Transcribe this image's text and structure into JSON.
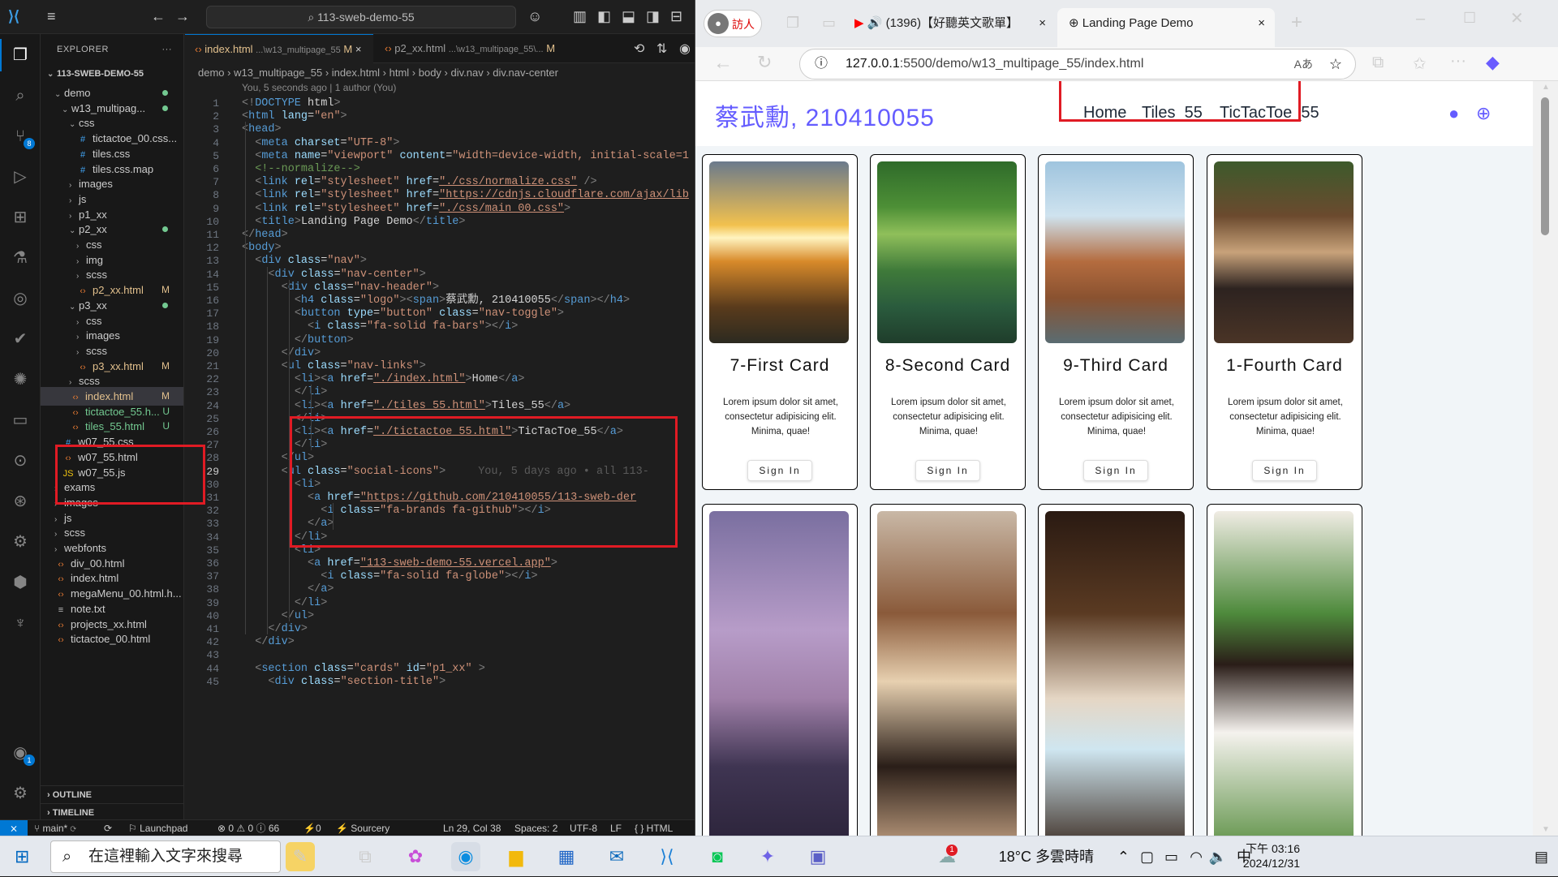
{
  "vscode": {
    "command_center": "113-sweb-demo-55",
    "explorer": {
      "title": "EXPLORER",
      "more": "···",
      "root": "113-SWEB-DEMO-55",
      "items": [
        {
          "label": "demo",
          "indent": 1,
          "type": "folder",
          "open": true,
          "state": "dot"
        },
        {
          "label": "w13_multipag...",
          "indent": 2,
          "type": "folder",
          "open": true,
          "state": "dot"
        },
        {
          "label": "css",
          "indent": 3,
          "type": "folder",
          "open": true,
          "state": ""
        },
        {
          "label": "tictactoe_00.css...",
          "indent": 4,
          "type": "css",
          "state": ""
        },
        {
          "label": "tiles.css",
          "indent": 4,
          "type": "css",
          "state": ""
        },
        {
          "label": "tiles.css.map",
          "indent": 4,
          "type": "css",
          "state": ""
        },
        {
          "label": "images",
          "indent": 3,
          "type": "folder",
          "open": false,
          "state": ""
        },
        {
          "label": "js",
          "indent": 3,
          "type": "folder",
          "open": false,
          "state": ""
        },
        {
          "label": "p1_xx",
          "indent": 3,
          "type": "folder",
          "open": false,
          "state": ""
        },
        {
          "label": "p2_xx",
          "indent": 3,
          "type": "folder",
          "open": true,
          "state": "dot"
        },
        {
          "label": "css",
          "indent": 4,
          "type": "folder",
          "open": false,
          "state": ""
        },
        {
          "label": "img",
          "indent": 4,
          "type": "folder",
          "open": false,
          "state": ""
        },
        {
          "label": "scss",
          "indent": 4,
          "type": "folder",
          "open": false,
          "state": ""
        },
        {
          "label": "p2_xx.html",
          "indent": 4,
          "type": "html",
          "state": "M"
        },
        {
          "label": "p3_xx",
          "indent": 3,
          "type": "folder",
          "open": true,
          "state": "dot"
        },
        {
          "label": "css",
          "indent": 4,
          "type": "folder",
          "open": false,
          "state": ""
        },
        {
          "label": "images",
          "indent": 4,
          "type": "folder",
          "open": false,
          "state": ""
        },
        {
          "label": "scss",
          "indent": 4,
          "type": "folder",
          "open": false,
          "state": ""
        },
        {
          "label": "p3_xx.html",
          "indent": 4,
          "type": "html",
          "state": "M"
        },
        {
          "label": "scss",
          "indent": 3,
          "type": "folder",
          "open": false,
          "state": ""
        },
        {
          "label": "index.html",
          "indent": 3,
          "type": "html",
          "state": "M",
          "selected": true
        },
        {
          "label": "tictactoe_55.h...",
          "indent": 3,
          "type": "html",
          "state": "U"
        },
        {
          "label": "tiles_55.html",
          "indent": 3,
          "type": "html",
          "state": "U"
        },
        {
          "label": "w07_55.css",
          "indent": 2,
          "type": "css",
          "state": ""
        },
        {
          "label": "w07_55.html",
          "indent": 2,
          "type": "html",
          "state": ""
        },
        {
          "label": "w07_55.js",
          "indent": 2,
          "type": "js",
          "state": ""
        },
        {
          "label": "exams",
          "indent": 1,
          "type": "folder",
          "open": false,
          "state": ""
        },
        {
          "label": "images",
          "indent": 1,
          "type": "folder",
          "open": false,
          "state": ""
        },
        {
          "label": "js",
          "indent": 1,
          "type": "folder",
          "open": false,
          "state": ""
        },
        {
          "label": "scss",
          "indent": 1,
          "type": "folder",
          "open": false,
          "state": ""
        },
        {
          "label": "webfonts",
          "indent": 1,
          "type": "folder",
          "open": false,
          "state": ""
        },
        {
          "label": "div_00.html",
          "indent": 1,
          "type": "html",
          "state": ""
        },
        {
          "label": "index.html",
          "indent": 1,
          "type": "html",
          "state": ""
        },
        {
          "label": "megaMenu_00.html.h...",
          "indent": 1,
          "type": "html",
          "state": ""
        },
        {
          "label": "note.txt",
          "indent": 1,
          "type": "txt",
          "state": ""
        },
        {
          "label": "projects_xx.html",
          "indent": 1,
          "type": "html",
          "state": ""
        },
        {
          "label": "tictactoe_00.html",
          "indent": 1,
          "type": "html",
          "state": ""
        }
      ],
      "outline": "OUTLINE",
      "timeline": "TIMELINE"
    },
    "tabs": [
      {
        "name": "index.html",
        "path": "...\\w13_multipage_55",
        "state": "M",
        "close": "×"
      },
      {
        "name": "p2_xx.html",
        "path": "...\\w13_multipage_55\\...",
        "state": "M"
      }
    ],
    "breadcrumb": [
      "demo",
      "w13_multipage_55",
      "index.html",
      "html",
      "body",
      "div.nav",
      "div.nav-center"
    ],
    "blame": "You, 5 seconds ago | 1 author (You)",
    "inline_blame": "You, 5 days ago • all 113-",
    "code": [
      "<!DOCTYPE html>",
      "<html lang=\"en\">",
      "<head>",
      "  <meta charset=\"UTF-8\">",
      "  <meta name=\"viewport\" content=\"width=device-width, initial-scale=1",
      "  <!--normalize-->",
      "  <link rel=\"stylesheet\" href=\"./css/normalize.css\" />",
      "  <link rel=\"stylesheet\" href=\"https://cdnjs.cloudflare.com/ajax/lib",
      "  <link rel=\"stylesheet\" href=\"./css/main_00.css\">",
      "  <title>Landing Page Demo</title>",
      "</head>",
      "<body>",
      "  <div class=\"nav\">",
      "    <div class=\"nav-center\">",
      "      <div class=\"nav-header\">",
      "        <h4 class=\"logo\"><span>蔡武勳, 210410055</span></h4>",
      "        <button type=\"button\" class=\"nav-toggle\">",
      "          <i class=\"fa-solid fa-bars\"></i>",
      "        </button>",
      "      </div>",
      "      <ul class=\"nav-links\">",
      "        <li><a href=\"./index.html\">Home</a>",
      "        </li>",
      "        <li><a href=\"./tiles_55.html\">Tiles_55</a>",
      "        </li>",
      "        <li><a href=\"./tictactoe_55.html\">TicTacToe_55</a>",
      "        </li>",
      "      </ul>",
      "      <ul class=\"social-icons\">",
      "        <li>",
      "          <a href=\"https://github.com/210410055/113-sweb-der",
      "            <i class=\"fa-brands fa-github\"></i>",
      "          </a>",
      "        </li>",
      "        <li>",
      "          <a href=\"113-sweb-demo-55.vercel.app\">",
      "            <i class=\"fa-solid fa-globe\"></i>",
      "          </a>",
      "        </li>",
      "      </ul>",
      "    </div>",
      "  </div>",
      "",
      "  <section class=\"cards\" id=\"p1_xx\" >",
      "    <div class=\"section-title\">"
    ],
    "current_line": 29,
    "status": {
      "branch": "main*",
      "launchpad": "Launchpad",
      "problems": "⊗ 0 ⚠ 0 ⓘ 66",
      "ports": "⚡0",
      "sourcery": "Sourcery",
      "position": "Ln 29, Col 38",
      "spaces": "Spaces: 2",
      "encoding": "UTF-8",
      "eol": "LF",
      "language": "{ } HTML"
    }
  },
  "browser": {
    "profile": "訪人",
    "tabs": [
      {
        "title": "(1396)【好聽英文歌單】",
        "close": "×"
      },
      {
        "title": "Landing Page Demo",
        "close": "×"
      }
    ],
    "url_host": "127.0.0.1",
    "url_rest": ":5500/demo/w13_multipage_55/index.html",
    "read_aloud": "Aあ",
    "page": {
      "logo": "蔡武勳, 210410055",
      "nav_links": [
        "Home",
        "Tiles_55",
        "TicTacToe_55"
      ],
      "cards": [
        {
          "title": "7-First Card",
          "text": "Lorem ipsum dolor sit amet, consectetur adipisicing elit. Minima, quae!",
          "button": "Sign In",
          "img": "sunset"
        },
        {
          "title": "8-Second Card",
          "text": "Lorem ipsum dolor sit amet, consectetur adipisicing elit. Minima, quae!",
          "button": "Sign In",
          "img": "forest"
        },
        {
          "title": "9-Third Card",
          "text": "Lorem ipsum dolor sit amet, consectetur adipisicing elit. Minima, quae!",
          "button": "Sign In",
          "img": "rocks"
        },
        {
          "title": "1-Fourth Card",
          "text": "Lorem ipsum dolor sit amet, consectetur adipisicing elit. Minima, quae!",
          "button": "Sign In",
          "img": "coffee"
        }
      ],
      "cards_row2": [
        {
          "img": "bridge"
        },
        {
          "img": "coffee-hands"
        },
        {
          "img": "cup"
        },
        {
          "img": "coffee-plant"
        }
      ]
    }
  },
  "taskbar": {
    "search_placeholder": "在這裡輸入文字來搜尋",
    "weather": "18°C 多雲時晴",
    "ime": "中",
    "time": "下午 03:16",
    "date": "2024/12/31",
    "weather_badge": "1"
  }
}
